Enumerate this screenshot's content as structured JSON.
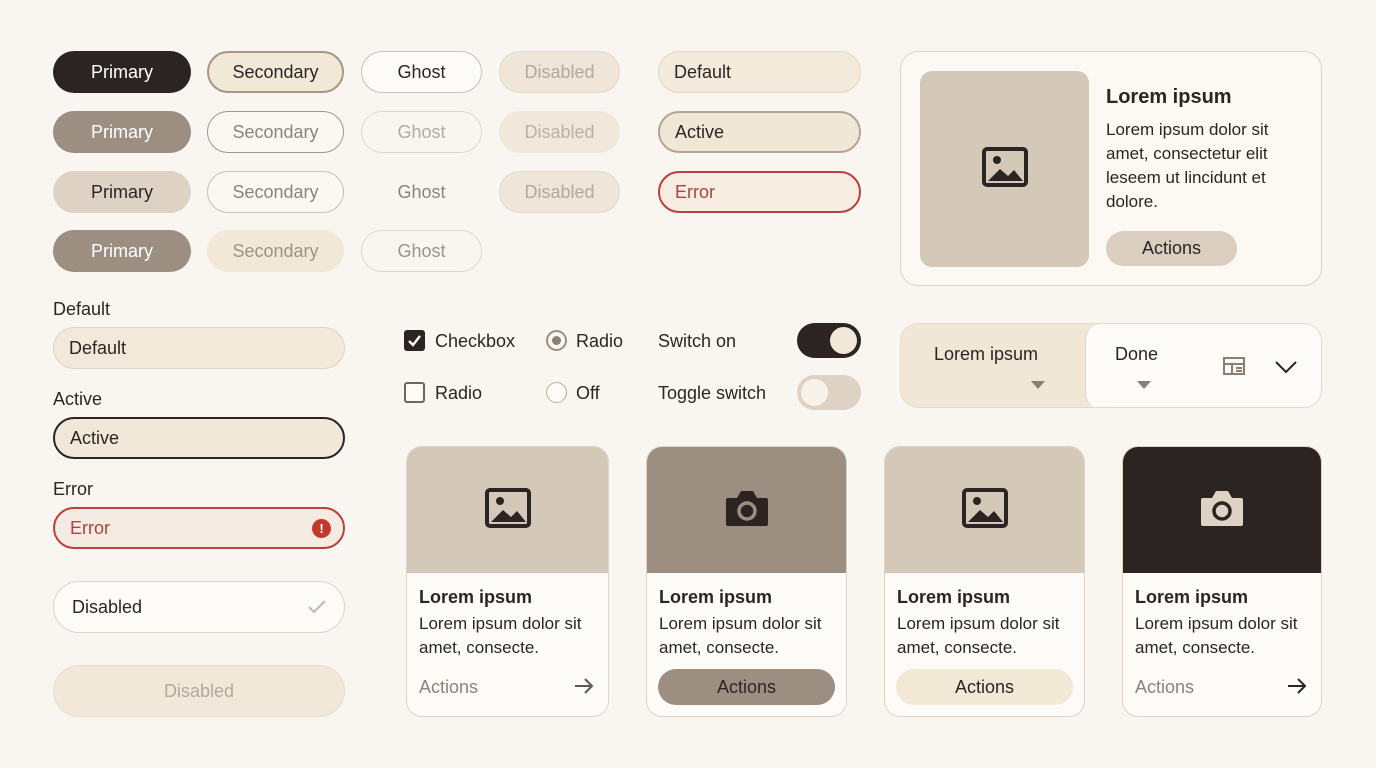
{
  "buttons": {
    "row1": [
      "Primary",
      "Secondary",
      "Ghost",
      "Disabled"
    ],
    "row2": [
      "Primary",
      "Secondary",
      "Ghost",
      "Disabled"
    ],
    "row3": [
      "Primary",
      "Secondary",
      "Ghost",
      "Disabled"
    ],
    "row4": [
      "Primary",
      "Secondary",
      "Ghost"
    ]
  },
  "pill_states": [
    "Default",
    "Active",
    "Error"
  ],
  "feature_card": {
    "title": "Lorem ipsum",
    "body": "Lorem ipsum dolor sit amet, consectetur elit leseem ut lincidunt et dolore.",
    "action": "Actions"
  },
  "form": {
    "default_label": "Default",
    "default_value": "Default",
    "active_label": "Active",
    "active_value": "Active",
    "error_label": "Error",
    "error_value": "Error",
    "disabled_check_value": "Disabled",
    "disabled_value": "Disabled"
  },
  "controls": {
    "checkbox_checked": "Checkbox",
    "checkbox_unchecked": "Radio",
    "radio_selected": "Radio",
    "radio_off": "Off",
    "switch_on_label": "Switch on",
    "toggle_label": "Toggle switch",
    "switch_on": true,
    "toggle_on": false
  },
  "segmented": {
    "left": "Lorem ipsum",
    "right": "Done"
  },
  "cards": [
    {
      "title": "Lorem ipsum",
      "body": "Lorem ipsum dolor sit amet, consecte.",
      "action": "Actions",
      "icon": "image-icon"
    },
    {
      "title": "Lorem ipsum",
      "body": "Lorem ipsum dolor sit amet, consecte.",
      "action": "Actions",
      "icon": "camera-icon"
    },
    {
      "title": "Lorem ipsum",
      "body": "Lorem ipsum dolor sit amet, consecte.",
      "action": "Actions",
      "icon": "image-icon"
    },
    {
      "title": "Lorem ipsum",
      "body": "Lorem ipsum dolor sit amet, consecte.",
      "action": "Actions",
      "icon": "camera-icon"
    }
  ],
  "colors": {
    "background": "#f9f6f1",
    "dark": "#2c2423",
    "taupe": "#9c8e80",
    "sand": "#ddd2c4",
    "cream": "#f1e8d8",
    "error": "#b8403d"
  }
}
